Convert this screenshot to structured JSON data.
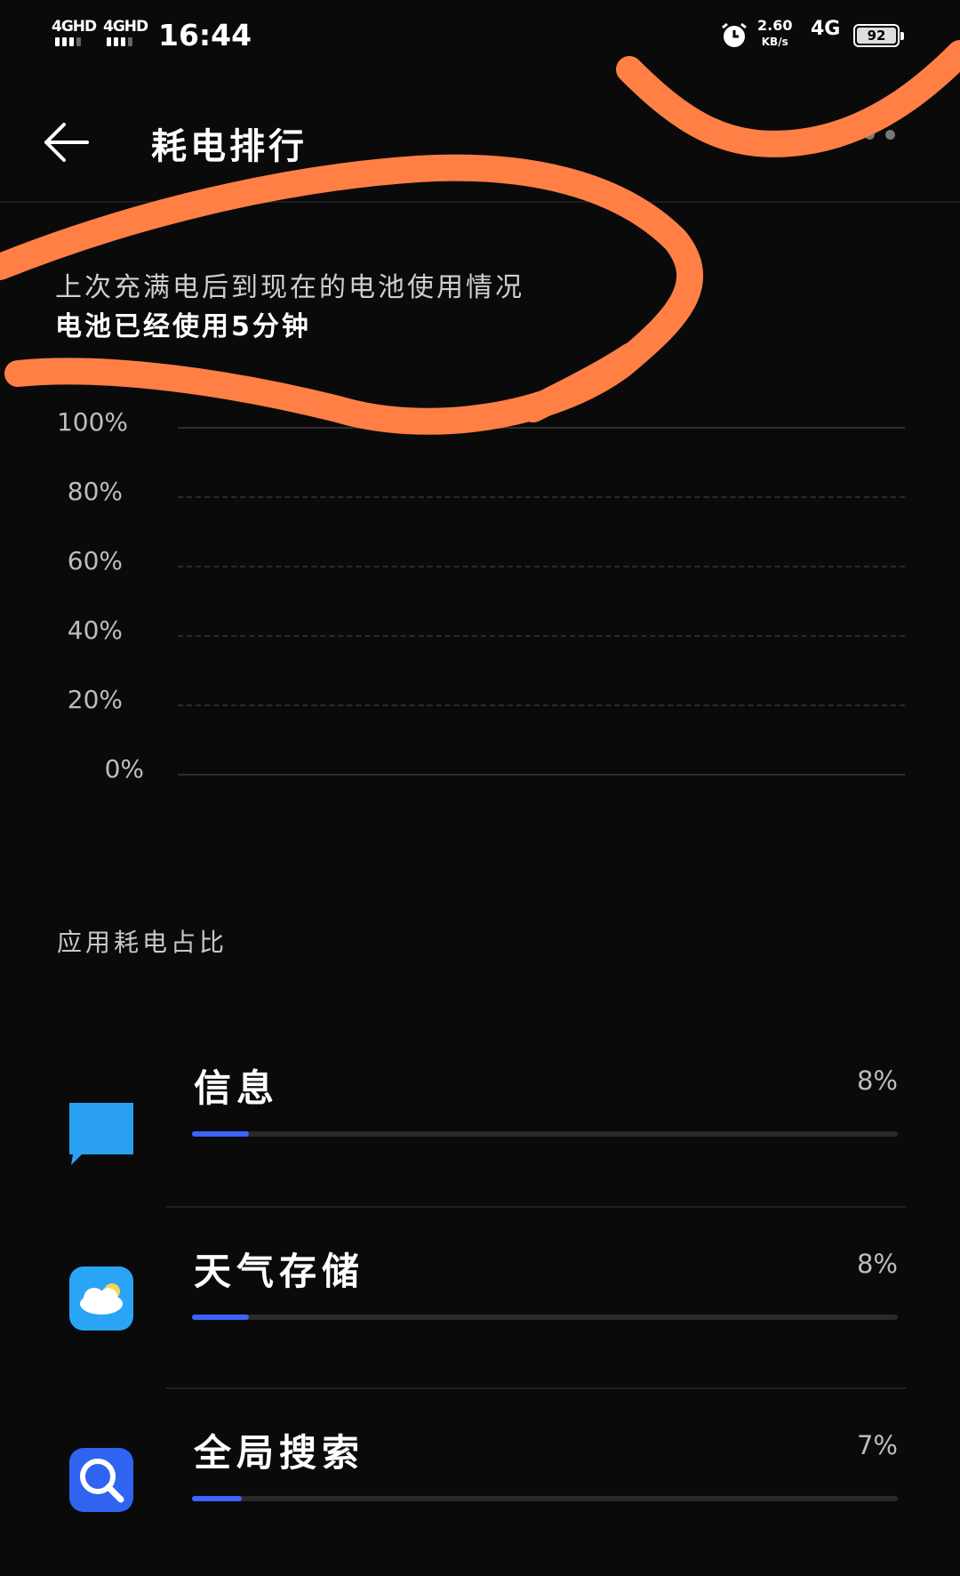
{
  "status_bar": {
    "signal1": "4GHD",
    "signal2": "4GHD",
    "time": "16:44",
    "net_speed": "2.60",
    "net_unit": "KB/s",
    "network": "4G",
    "battery": "92"
  },
  "header": {
    "title": "耗电排行"
  },
  "summary": {
    "line1": "上次充满电后到现在的电池使用情况",
    "line2": "电池已经使用5分钟"
  },
  "chart_data": {
    "type": "area",
    "y_ticks": [
      "100%",
      "80%",
      "60%",
      "40%",
      "20%",
      "0%"
    ],
    "ylim": [
      0,
      100
    ],
    "series": [],
    "grid": true
  },
  "section": {
    "title": "应用耗电占比"
  },
  "apps": [
    {
      "name": "信息",
      "percent_label": "8%",
      "percent": 8,
      "icon": "message-icon"
    },
    {
      "name": "天气存储",
      "percent_label": "8%",
      "percent": 8,
      "icon": "weather-icon"
    },
    {
      "name": "全局搜索",
      "percent_label": "7%",
      "percent": 7,
      "icon": "search-icon"
    }
  ],
  "colors": {
    "accent": "#3d63ff",
    "annotation": "#ff7f45"
  }
}
